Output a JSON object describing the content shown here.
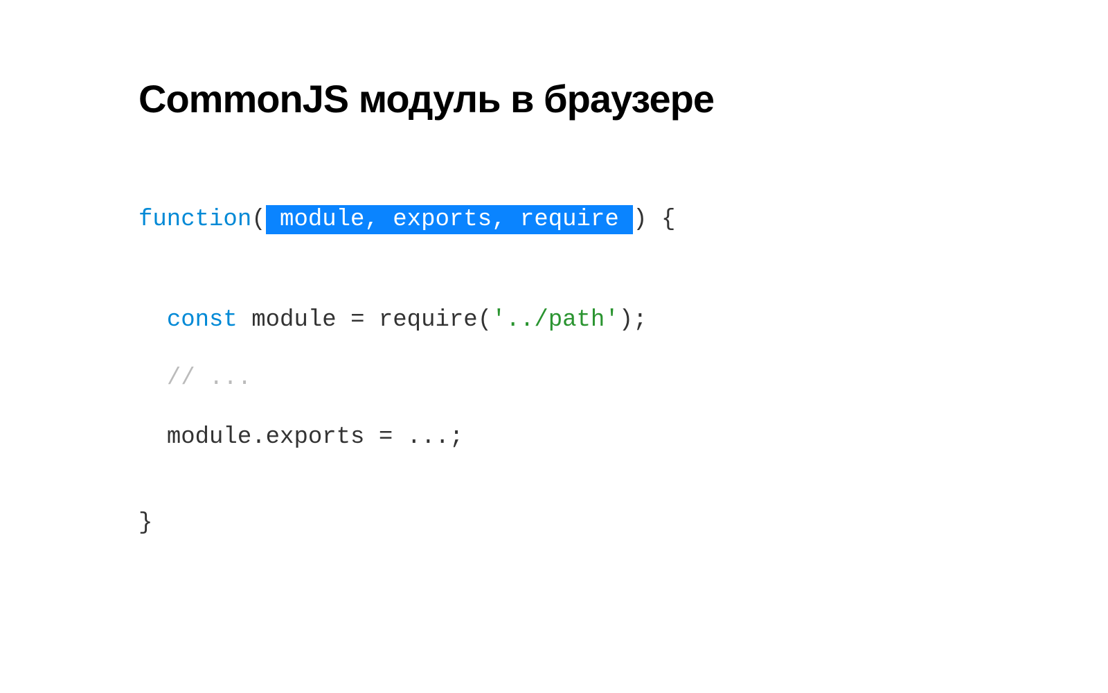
{
  "title": "CommonJS модуль в браузере",
  "code": {
    "line1": {
      "keyword": "function",
      "paren_open": "(",
      "highlight": " module, exports, require ",
      "paren_close_brace": ") {"
    },
    "line2": {
      "indent": "  ",
      "keyword": "const",
      "text_before_string": " module = require(",
      "string": "'../path'",
      "text_after_string": ");"
    },
    "line3": {
      "indent": "  ",
      "comment": "// ..."
    },
    "line4": {
      "indent": "  ",
      "text": "module.exports = ...;"
    },
    "line5": {
      "text": "}"
    }
  }
}
